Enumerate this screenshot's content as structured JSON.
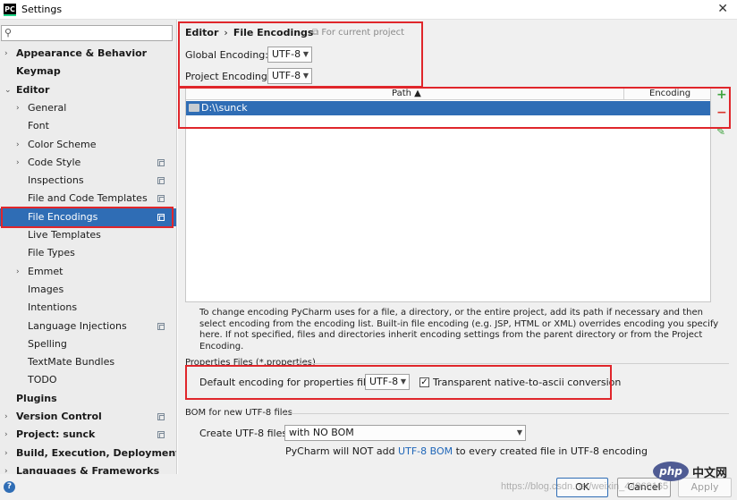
{
  "window": {
    "title": "Settings",
    "app_icon": "PC"
  },
  "sidebar": {
    "search_placeholder": "",
    "items": [
      {
        "label": "Appearance & Behavior",
        "arrow": ">",
        "bold": true
      },
      {
        "label": "Keymap",
        "arrow": "",
        "bold": true
      },
      {
        "label": "Editor",
        "arrow": "v",
        "bold": true
      },
      {
        "label": "General",
        "arrow": ">",
        "bold": false
      },
      {
        "label": "Font",
        "arrow": "",
        "bold": false
      },
      {
        "label": "Color Scheme",
        "arrow": ">",
        "bold": false
      },
      {
        "label": "Code Style",
        "arrow": ">",
        "bold": false
      },
      {
        "label": "Inspections",
        "arrow": "",
        "bold": false
      },
      {
        "label": "File and Code Templates",
        "arrow": "",
        "bold": false
      },
      {
        "label": "File Encodings",
        "arrow": "",
        "bold": false,
        "selected": true
      },
      {
        "label": "Live Templates",
        "arrow": "",
        "bold": false
      },
      {
        "label": "File Types",
        "arrow": "",
        "bold": false
      },
      {
        "label": "Emmet",
        "arrow": ">",
        "bold": false
      },
      {
        "label": "Images",
        "arrow": "",
        "bold": false
      },
      {
        "label": "Intentions",
        "arrow": "",
        "bold": false
      },
      {
        "label": "Language Injections",
        "arrow": "",
        "bold": false
      },
      {
        "label": "Spelling",
        "arrow": "",
        "bold": false
      },
      {
        "label": "TextMate Bundles",
        "arrow": "",
        "bold": false
      },
      {
        "label": "TODO",
        "arrow": "",
        "bold": false
      },
      {
        "label": "Plugins",
        "arrow": "",
        "bold": true
      },
      {
        "label": "Version Control",
        "arrow": ">",
        "bold": true
      },
      {
        "label": "Project: sunck",
        "arrow": ">",
        "bold": true
      },
      {
        "label": "Build, Execution, Deployment",
        "arrow": ">",
        "bold": true
      },
      {
        "label": "Languages & Frameworks",
        "arrow": ">",
        "bold": true
      }
    ]
  },
  "main": {
    "breadcrumb": {
      "parent": "Editor",
      "separator": "›",
      "current": "File Encodings"
    },
    "scope_hint": "For current project",
    "global_encoding": {
      "label": "Global Encoding:",
      "value": "UTF-8"
    },
    "project_encoding": {
      "label": "Project Encoding:",
      "value": "UTF-8"
    },
    "table": {
      "col_path": "Path ▲",
      "col_encoding": "Encoding",
      "rows": [
        {
          "path": "D:\\\\sunck",
          "encoding": ""
        }
      ]
    },
    "tools": {
      "add": "+",
      "remove": "−",
      "edit": "✎"
    },
    "help_text": "To change encoding PyCharm uses for a file, a directory, or the entire project, add its path if necessary and then select encoding from the encoding list. Built-in file encoding (e.g. JSP, HTML or XML) overrides encoding you specify here. If not specified, files and directories inherit encoding settings from the parent directory or from the Project Encoding.",
    "properties_section": {
      "title": "Properties Files (*.properties)",
      "default_label": "Default encoding for properties files:",
      "default_value": "UTF-8",
      "transparent_label": "Transparent native-to-ascii conversion",
      "transparent_checked": "✓"
    },
    "bom_section": {
      "title": "BOM for new UTF-8 files",
      "create_label": "Create UTF-8 files:",
      "create_value": "with NO BOM",
      "note_prefix": "PyCharm will NOT add ",
      "note_link": "UTF-8 BOM",
      "note_suffix": " to every created file in UTF-8 encoding"
    }
  },
  "footer": {
    "help": "?",
    "ok": "OK",
    "cancel": "Cancel",
    "apply": "Apply",
    "watermark": "https://blog.csdn.net/weixin_44960165",
    "php_logo": "php",
    "php_cn": "中文网"
  },
  "colors": {
    "selection": "#2f6db5",
    "highlight_box": "#e0262b",
    "add": "#3ea33e",
    "remove": "#d9342b"
  }
}
